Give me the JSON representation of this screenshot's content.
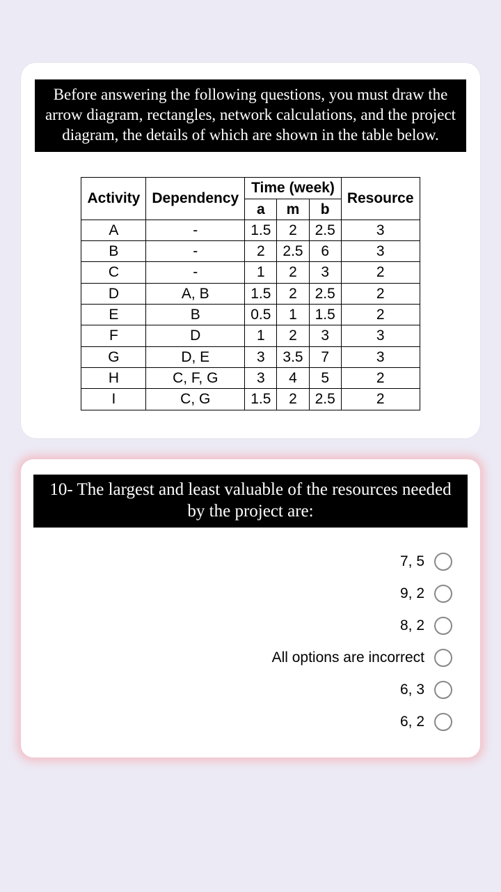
{
  "instruction": "Before answering the following questions, you must draw the arrow diagram, rectangles, network calculations, and the project diagram, the details of which are shown in the table below.",
  "table": {
    "headers": {
      "activity": "Activity",
      "dependency": "Dependency",
      "time_group": "Time (week)",
      "a": "a",
      "m": "m",
      "b": "b",
      "resource": "Resource"
    },
    "rows": [
      {
        "activity": "A",
        "dependency": "-",
        "a": "1.5",
        "m": "2",
        "b": "2.5",
        "resource": "3"
      },
      {
        "activity": "B",
        "dependency": "-",
        "a": "2",
        "m": "2.5",
        "b": "6",
        "resource": "3"
      },
      {
        "activity": "C",
        "dependency": "-",
        "a": "1",
        "m": "2",
        "b": "3",
        "resource": "2"
      },
      {
        "activity": "D",
        "dependency": "A, B",
        "a": "1.5",
        "m": "2",
        "b": "2.5",
        "resource": "2"
      },
      {
        "activity": "E",
        "dependency": "B",
        "a": "0.5",
        "m": "1",
        "b": "1.5",
        "resource": "2"
      },
      {
        "activity": "F",
        "dependency": "D",
        "a": "1",
        "m": "2",
        "b": "3",
        "resource": "3"
      },
      {
        "activity": "G",
        "dependency": "D, E",
        "a": "3",
        "m": "3.5",
        "b": "7",
        "resource": "3"
      },
      {
        "activity": "H",
        "dependency": "C, F, G",
        "a": "3",
        "m": "4",
        "b": "5",
        "resource": "2"
      },
      {
        "activity": "I",
        "dependency": "C, G",
        "a": "1.5",
        "m": "2",
        "b": "2.5",
        "resource": "2"
      }
    ]
  },
  "question": "10- The largest and least valuable of the resources needed by the project are:",
  "options": [
    "7, 5",
    "9, 2",
    "8, 2",
    "All options are incorrect",
    "6, 3",
    "6, 2"
  ]
}
